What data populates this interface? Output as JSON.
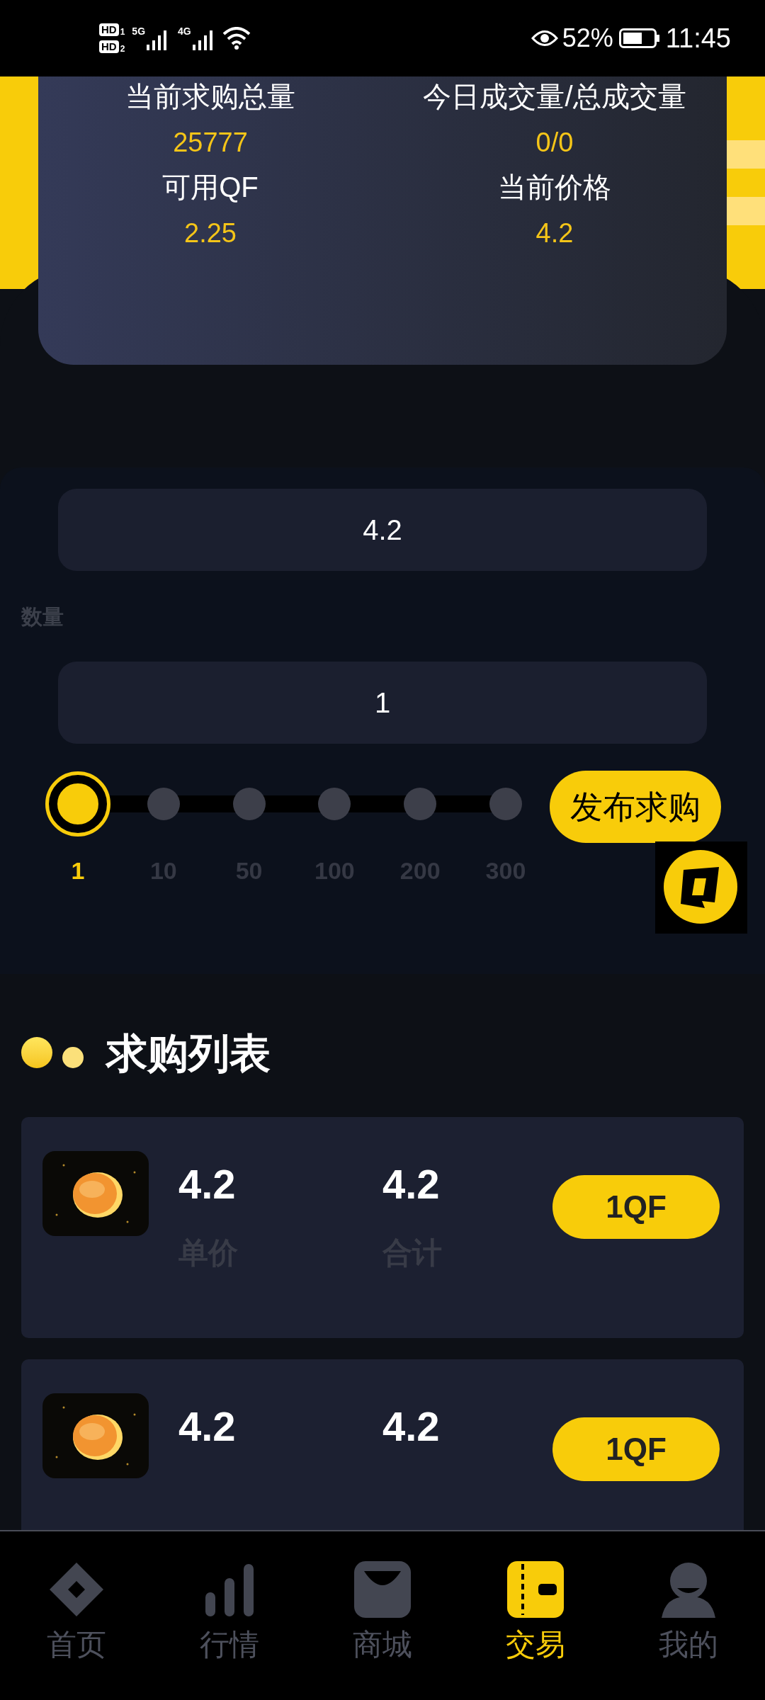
{
  "status_bar": {
    "sims": [
      {
        "label": "HD",
        "slot": "1"
      },
      {
        "label": "HD",
        "slot": "2"
      }
    ],
    "networks": [
      "5G",
      "4G"
    ],
    "battery": "52%",
    "time": "11:45"
  },
  "stats": [
    {
      "label": "当前求购总量",
      "value": "25777"
    },
    {
      "label": "今日成交量/总成交量",
      "value": "0/0"
    },
    {
      "label": "可用QF",
      "value": "2.25"
    },
    {
      "label": "当前价格",
      "value": "4.2"
    }
  ],
  "form": {
    "price_value": "4.2",
    "quantity_label": "数量",
    "quantity_value": "1",
    "stops": [
      {
        "label": "1",
        "selected": true
      },
      {
        "label": "10",
        "selected": false
      },
      {
        "label": "50",
        "selected": false
      },
      {
        "label": "100",
        "selected": false
      },
      {
        "label": "200",
        "selected": false
      },
      {
        "label": "300",
        "selected": false
      }
    ],
    "submit": "发布求购"
  },
  "list": {
    "title": "求购列表",
    "rows": [
      {
        "price": "4.2",
        "price_label": "单价",
        "total": "4.2",
        "total_label": "合计",
        "button": "1QF"
      },
      {
        "price": "4.2",
        "total": "4.2",
        "button": "1QF"
      }
    ]
  },
  "nav": [
    {
      "label": "首页",
      "kind": "home",
      "selected": false
    },
    {
      "label": "行情",
      "kind": "market",
      "selected": false
    },
    {
      "label": "商城",
      "kind": "shop",
      "selected": false
    },
    {
      "label": "交易",
      "kind": "trade",
      "selected": true
    },
    {
      "label": "我的",
      "kind": "me",
      "selected": false
    }
  ]
}
